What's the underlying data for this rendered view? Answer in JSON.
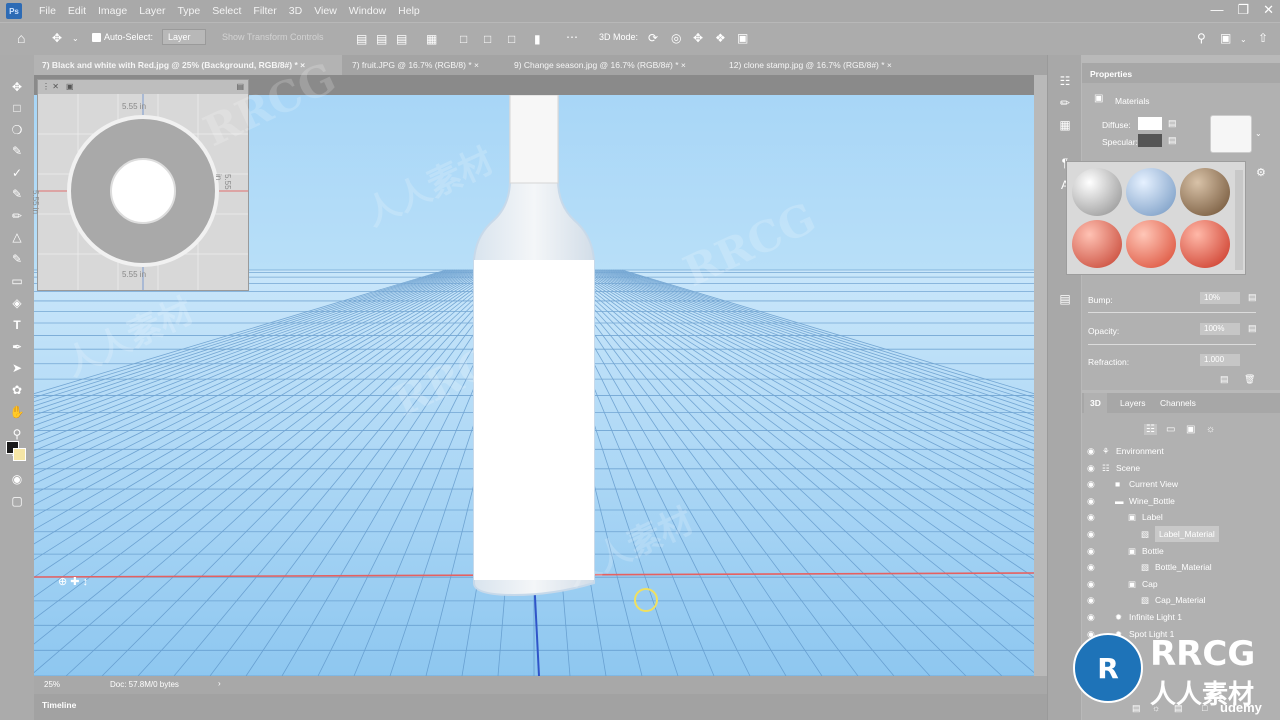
{
  "app": {
    "logo": "Ps"
  },
  "menu": [
    "File",
    "Edit",
    "Image",
    "Layer",
    "Type",
    "Select",
    "Filter",
    "3D",
    "View",
    "Window",
    "Help"
  ],
  "options_bar": {
    "auto_select_label": "Auto-Select:",
    "auto_select_value": "Layer",
    "show_transform_controls": "Show Transform Controls",
    "mode_label": "3D Mode:"
  },
  "tabs": [
    {
      "label": "7) Black and white with Red.jpg @ 25% (Background, RGB/8#) *",
      "active": true
    },
    {
      "label": "7) fruit.JPG @ 16.7% (RGB/8) *",
      "active": false
    },
    {
      "label": "9) Change season.jpg @ 16.7% (RGB/8#) *",
      "active": false
    },
    {
      "label": "12) clone stamp.jpg @ 16.7% (RGB/8#) *",
      "active": false
    }
  ],
  "navigator": {
    "dim_top": "5.55 in",
    "dim_left": "5.55 in",
    "dim_right": "5.55 in",
    "dim_bottom": "5.55 in"
  },
  "status": {
    "zoom": "25%",
    "doc": "Doc: 57.8M/0 bytes"
  },
  "timeline_label": "Timeline",
  "properties": {
    "title": "Properties",
    "section": "Materials",
    "diffuse_label": "Diffuse:",
    "specular_label": "Specular:",
    "bump_label": "Bump:",
    "bump_value": "10%",
    "opacity_label": "Opacity:",
    "opacity_value": "100%",
    "refraction_label": "Refraction:",
    "refraction_value": "1.000"
  },
  "panel3d": {
    "tabs": [
      "3D",
      "Layers",
      "Channels"
    ],
    "rows": [
      {
        "label": "Environment",
        "icon": "environment-icon",
        "indent": 0
      },
      {
        "label": "Scene",
        "icon": "scene-icon",
        "indent": 0
      },
      {
        "label": "Current View",
        "icon": "camera-icon",
        "indent": 1
      },
      {
        "label": "Wine_Bottle",
        "icon": "folder-icon",
        "indent": 1
      },
      {
        "label": "Label",
        "icon": "mesh-icon",
        "indent": 2
      },
      {
        "label": "Label_Material",
        "icon": "material-icon",
        "indent": 3,
        "selected": true
      },
      {
        "label": "Bottle",
        "icon": "mesh-icon",
        "indent": 2
      },
      {
        "label": "Bottle_Material",
        "icon": "material-icon",
        "indent": 3
      },
      {
        "label": "Cap",
        "icon": "mesh-icon",
        "indent": 2
      },
      {
        "label": "Cap_Material",
        "icon": "material-icon",
        "indent": 3
      },
      {
        "label": "Infinite Light 1",
        "icon": "light-icon",
        "indent": 1
      },
      {
        "label": "Spot Light 1",
        "icon": "light-icon",
        "indent": 1
      }
    ]
  },
  "watermarks": {
    "main": "RRCG",
    "sub": "人人素材",
    "brand": "udemy"
  },
  "colors": {
    "sky": "#a9d6f7",
    "grid": "#5a8fc2",
    "accent_red": "#e05a5a"
  }
}
